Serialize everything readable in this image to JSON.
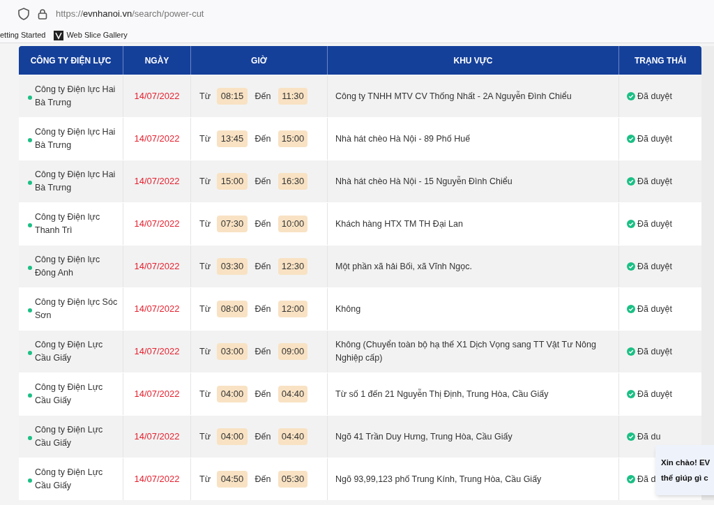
{
  "browser": {
    "url": {
      "scheme": "https://",
      "domain": "evnhanoi.vn",
      "path": "/search/power-cut"
    },
    "bookmarks": [
      {
        "label": "etting Started",
        "kind": "plain"
      },
      {
        "label": "Web Slice Gallery",
        "kind": "icon"
      }
    ]
  },
  "table": {
    "columns": [
      "CÔNG TY ĐIỆN LỰC",
      "NGÀY",
      "GIỜ",
      "KHU VỰC",
      "TRẠNG THÁI"
    ],
    "rows": [
      {
        "company": "Công ty Điện lực Hai Bà Trưng",
        "date": "14/07/2022",
        "from_label": "Từ",
        "from": "08:15",
        "to_label": "Đến",
        "to": "11:30",
        "area": "Công ty TNHH MTV CV Thống Nhất - 2A Nguyễn Đình Chiểu",
        "status": "Đã duyệt"
      },
      {
        "company": "Công ty Điện lực Hai Bà Trưng",
        "date": "14/07/2022",
        "from_label": "Từ",
        "from": "13:45",
        "to_label": "Đến",
        "to": "15:00",
        "area": "Nhà hát chèo Hà Nội - 89 Phố Huế",
        "status": "Đã duyệt"
      },
      {
        "company": "Công ty Điện lực Hai Bà Trưng",
        "date": "14/07/2022",
        "from_label": "Từ",
        "from": "15:00",
        "to_label": "Đến",
        "to": "16:30",
        "area": "Nhà hát chèo Hà Nội - 15 Nguyễn Đình Chiểu",
        "status": "Đã duyệt"
      },
      {
        "company": "Công ty Điện lực Thanh Trì",
        "date": "14/07/2022",
        "from_label": "Từ",
        "from": "07:30",
        "to_label": "Đến",
        "to": "10:00",
        "area": "Khách hàng HTX TM TH Đại Lan",
        "status": "Đã duyệt"
      },
      {
        "company": "Công ty Điện lực Đông Anh",
        "date": "14/07/2022",
        "from_label": "Từ",
        "from": "03:30",
        "to_label": "Đến",
        "to": "12:30",
        "area": "Một phần xã hải Bối, xã Vĩnh Ngọc.",
        "status": "Đã duyệt"
      },
      {
        "company": "Công ty Điện lực Sóc Sơn",
        "date": "14/07/2022",
        "from_label": "Từ",
        "from": "08:00",
        "to_label": "Đến",
        "to": "12:00",
        "area": "Không",
        "status": "Đã duyệt"
      },
      {
        "company": "Công ty Điện Lực Cầu Giấy",
        "date": "14/07/2022",
        "from_label": "Từ",
        "from": "03:00",
        "to_label": "Đến",
        "to": "09:00",
        "area": "Không (Chuyển toàn bộ hạ thế X1 Dịch Vọng sang TT Vật Tư Nông Nghiệp cấp)",
        "status": "Đã duyệt"
      },
      {
        "company": "Công ty Điện Lực Cầu Giấy",
        "date": "14/07/2022",
        "from_label": "Từ",
        "from": "04:00",
        "to_label": "Đến",
        "to": "04:40",
        "area": "Từ số 1 đến 21 Nguyễn Thị Định, Trung Hòa, Cầu Giấy",
        "status": "Đã duyệt"
      },
      {
        "company": "Công ty Điện Lực Cầu Giấy",
        "date": "14/07/2022",
        "from_label": "Từ",
        "from": "04:00",
        "to_label": "Đến",
        "to": "04:40",
        "area": "Ngõ 41 Trần Duy Hưng, Trung Hòa, Cầu Giấy",
        "status": "Đã du"
      },
      {
        "company": "Công ty Điện Lực Cầu Giấy",
        "date": "14/07/2022",
        "from_label": "Từ",
        "from": "04:50",
        "to_label": "Đến",
        "to": "05:30",
        "area": "Ngõ 93,99,123 phố Trung Kính, Trung Hòa, Cầu Giấy",
        "status": "Đã d"
      }
    ]
  },
  "chat_popup": {
    "lines": [
      "Xin chào! EV",
      "thể giúp gì c"
    ]
  }
}
